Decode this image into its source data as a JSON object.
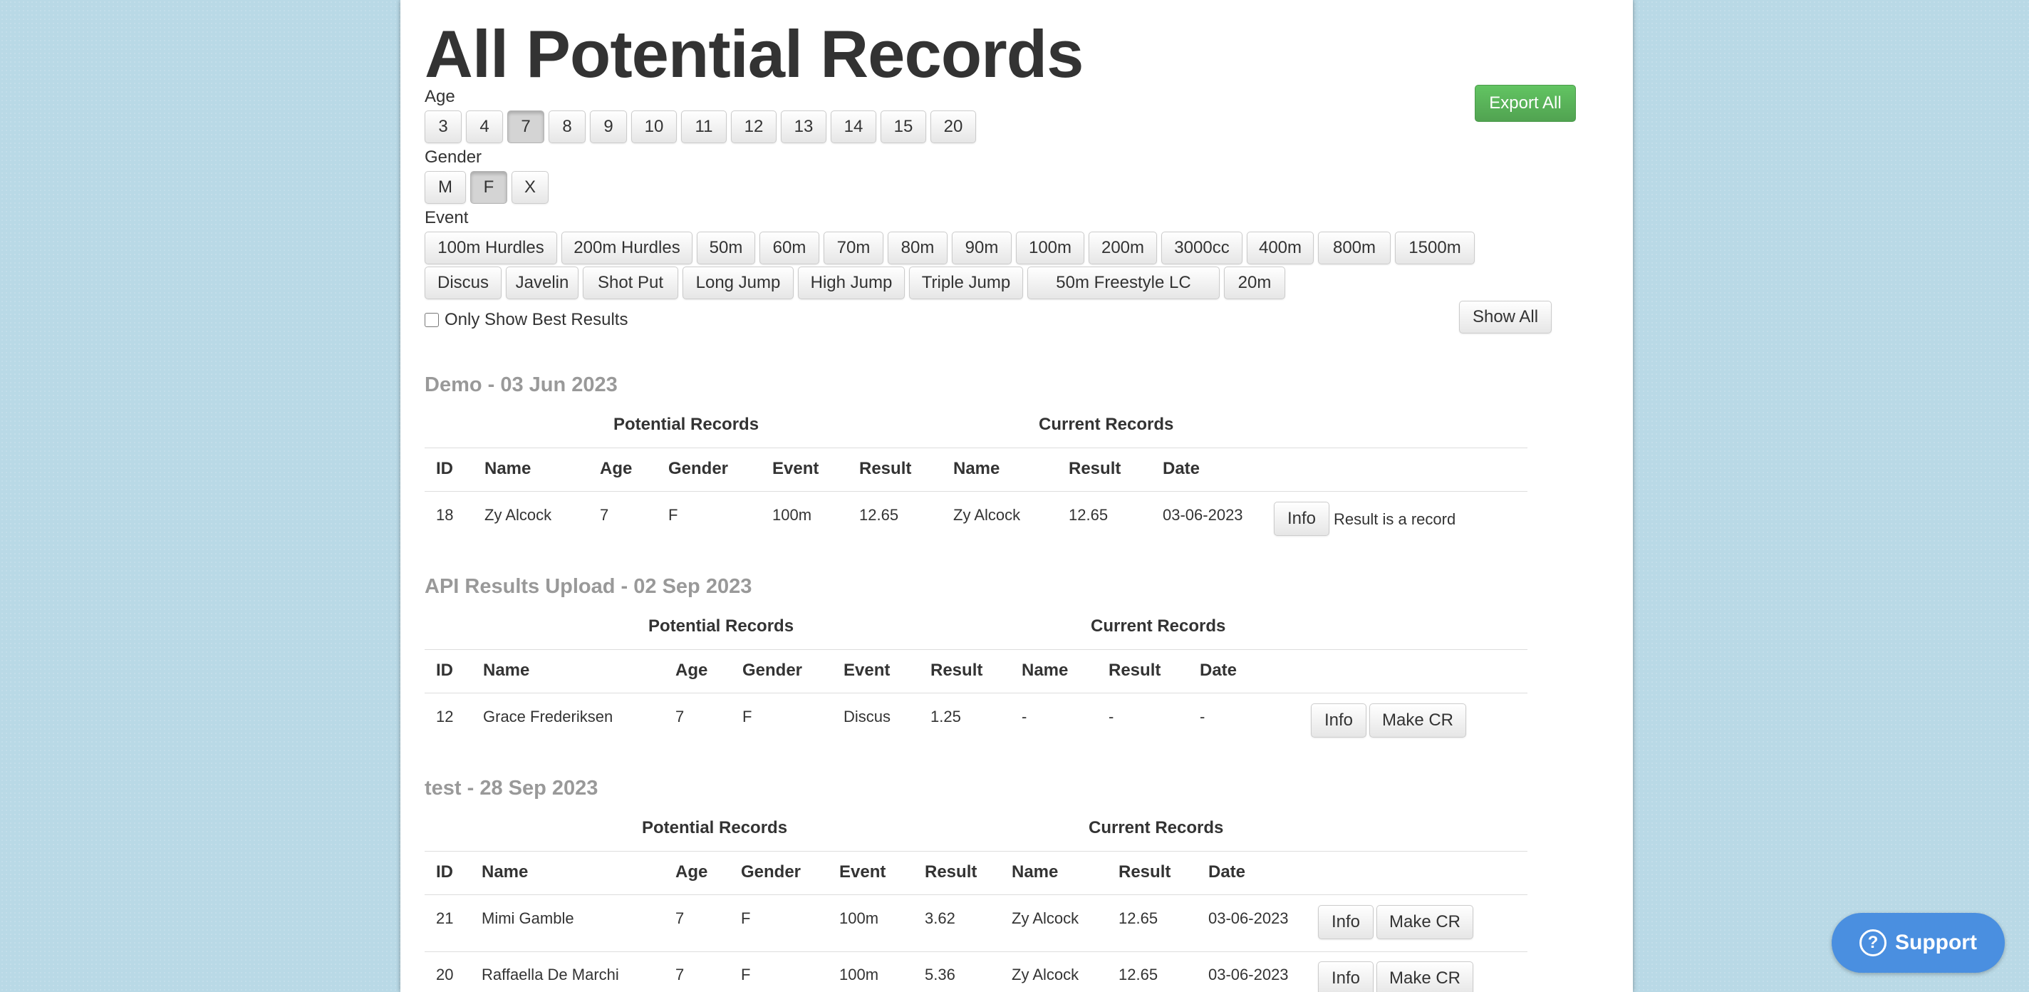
{
  "page": {
    "title": "All Potential Records",
    "export_label": "Export All",
    "show_all_label": "Show All"
  },
  "filters": {
    "age_label": "Age",
    "ages": [
      "3",
      "4",
      "7",
      "8",
      "9",
      "10",
      "11",
      "12",
      "13",
      "14",
      "15",
      "20"
    ],
    "age_selected": "7",
    "gender_label": "Gender",
    "genders": [
      "M",
      "F",
      "X"
    ],
    "gender_selected": "F",
    "event_label": "Event",
    "events_row1": [
      "100m Hurdles",
      "200m Hurdles",
      "50m",
      "60m",
      "70m",
      "80m",
      "90m",
      "100m",
      "200m",
      "3000cc",
      "400m",
      "800m",
      "1500m"
    ],
    "events_row2": [
      "Discus",
      "Javelin",
      "Shot Put",
      "Long Jump",
      "High Jump",
      "Triple Jump",
      "50m Freestyle LC",
      "20m"
    ],
    "best_only_label": "Only Show Best Results"
  },
  "headers": {
    "potential": "Potential Records",
    "current": "Current Records",
    "id": "ID",
    "name": "Name",
    "age": "Age",
    "gender": "Gender",
    "event": "Event",
    "result": "Result",
    "cur_name": "Name",
    "cur_result": "Result",
    "date": "Date"
  },
  "buttons": {
    "info": "Info",
    "make_cr": "Make CR"
  },
  "sections": [
    {
      "title": "Demo - 03 Jun 2023",
      "rows": [
        {
          "id": "18",
          "name": "Zy Alcock",
          "age": "7",
          "gender": "F",
          "event": "100m",
          "result": "12.65",
          "cur_name": "Zy Alcock",
          "cur_result": "12.65",
          "date": "03-06-2023",
          "status": "Result is a record"
        }
      ]
    },
    {
      "title": "API Results Upload - 02 Sep 2023",
      "rows": [
        {
          "id": "12",
          "name": "Grace Frederiksen",
          "age": "7",
          "gender": "F",
          "event": "Discus",
          "result": "1.25",
          "cur_name": "-",
          "cur_result": "-",
          "date": "-"
        }
      ]
    },
    {
      "title": "test - 28 Sep 2023",
      "rows": [
        {
          "id": "21",
          "name": "Mimi Gamble",
          "age": "7",
          "gender": "F",
          "event": "100m",
          "result": "3.62",
          "cur_name": "Zy Alcock",
          "cur_result": "12.65",
          "date": "03-06-2023"
        },
        {
          "id": "20",
          "name": "Raffaella De Marchi",
          "age": "7",
          "gender": "F",
          "event": "100m",
          "result": "5.36",
          "cur_name": "Zy Alcock",
          "cur_result": "12.65",
          "date": "03-06-2023"
        }
      ]
    }
  ],
  "support": {
    "label": "Support",
    "icon": "question-circle-icon"
  }
}
